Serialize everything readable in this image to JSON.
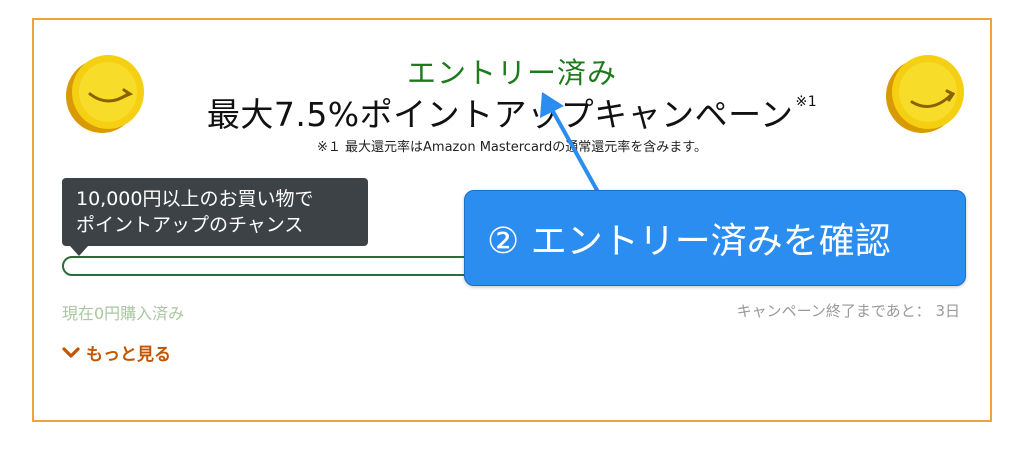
{
  "campaign": {
    "entry_status": "エントリー済み",
    "title": "最大7.5%ポイントアップキャンペーン",
    "title_note_mark": "※1",
    "footnote": "※１ 最大還元率はAmazon Mastercardの通常還元率を含みます。",
    "tooltip": {
      "line1": "10,000円以上のお買い物で",
      "line2": "ポイントアップのチャンス"
    },
    "progress": {
      "fraction": 0.0
    },
    "purchased_text": "現在0円購入済み",
    "remaining_text": "キャンペーン終了まであと： 3日",
    "more_label": "もっと見る"
  },
  "annotation": {
    "callout_text": "② エントリー済みを確認"
  },
  "icons": {
    "coin": "amazon-coin-icon",
    "more": "chevron-down-icon",
    "pointer": "arrow-icon"
  },
  "colors": {
    "border": "#f0a33a",
    "entry_green": "#1f7a1f",
    "link_orange": "#c45500",
    "callout_blue": "#2c8df0",
    "tooltip_bg": "#3d4246",
    "progress_border": "#2e6b3c"
  }
}
